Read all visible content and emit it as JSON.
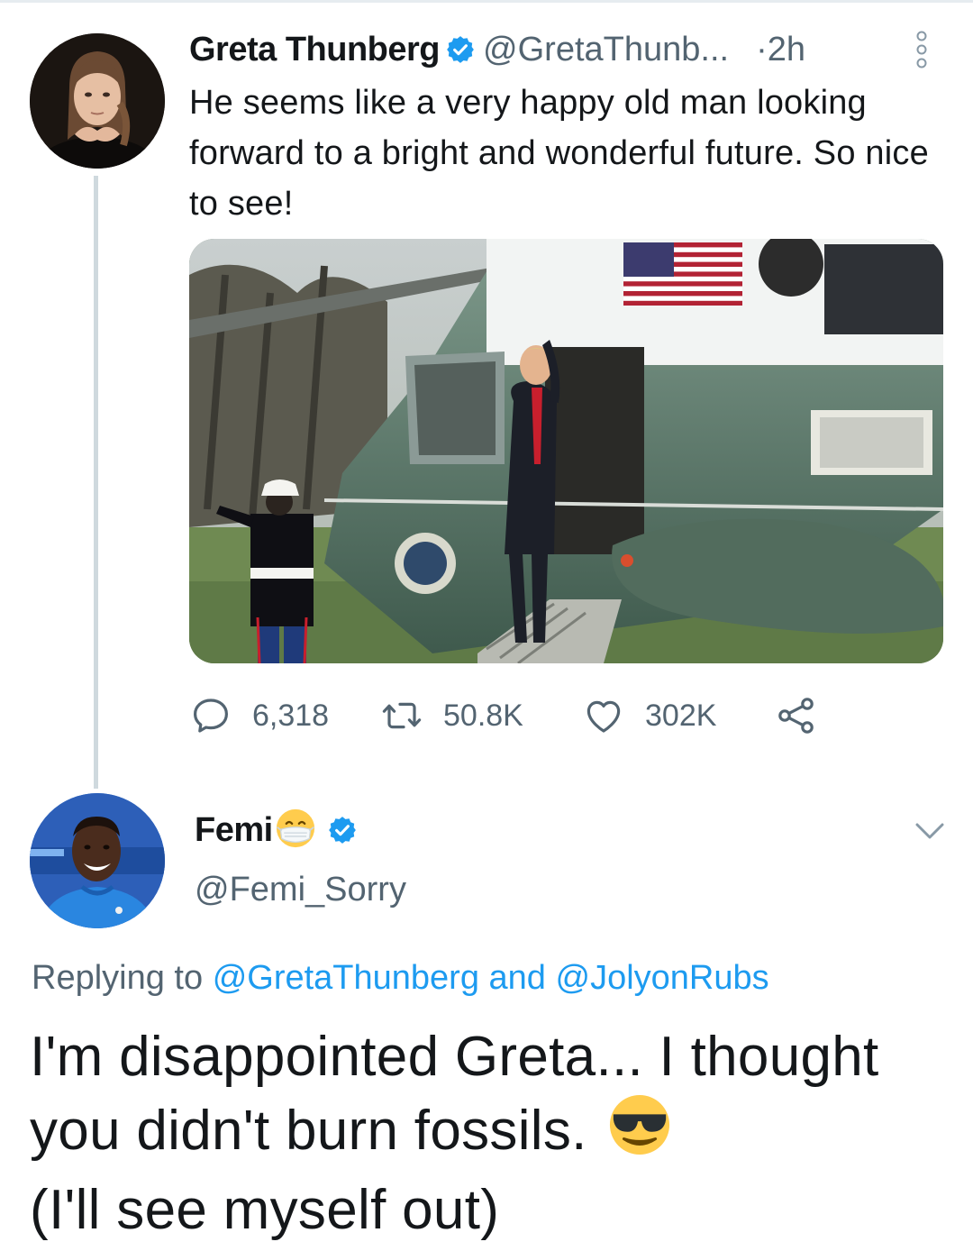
{
  "tweet": {
    "author_name": "Greta Thunberg",
    "author_handle": "@GretaThunb...",
    "time": "·2h",
    "text": "He seems like a very happy old man looking forward to a bright and wonderful future. So nice to see!",
    "stats": {
      "replies": "6,318",
      "retweets": "50.8K",
      "likes": "302K"
    }
  },
  "reply": {
    "author_name": "Femi",
    "author_handle": "@Femi_Sorry",
    "replying_prefix": "Replying to",
    "replying_mention_1": "@GretaThunberg",
    "replying_and": "and",
    "replying_mention_2": "@JolyonRubs",
    "text_line_1": "I'm disappointed Greta... I thought you didn't burn fossils.",
    "text_line_2": "(I'll see myself out)"
  },
  "icons": {
    "verified": "verified-badge-icon",
    "more": "more-vertical-icon",
    "reply": "comment-bubble-icon",
    "retweet": "retweet-icon",
    "like": "heart-icon",
    "share": "share-icon",
    "chevron": "chevron-down-icon",
    "mask_emoji": "face-with-medical-mask-emoji",
    "sunglasses_emoji": "smiling-face-with-sunglasses-emoji"
  },
  "colors": {
    "accent": "#1d9bf0",
    "secondary_text": "#536471",
    "primary_text": "#14171a",
    "thread_line": "#cfd9de"
  }
}
